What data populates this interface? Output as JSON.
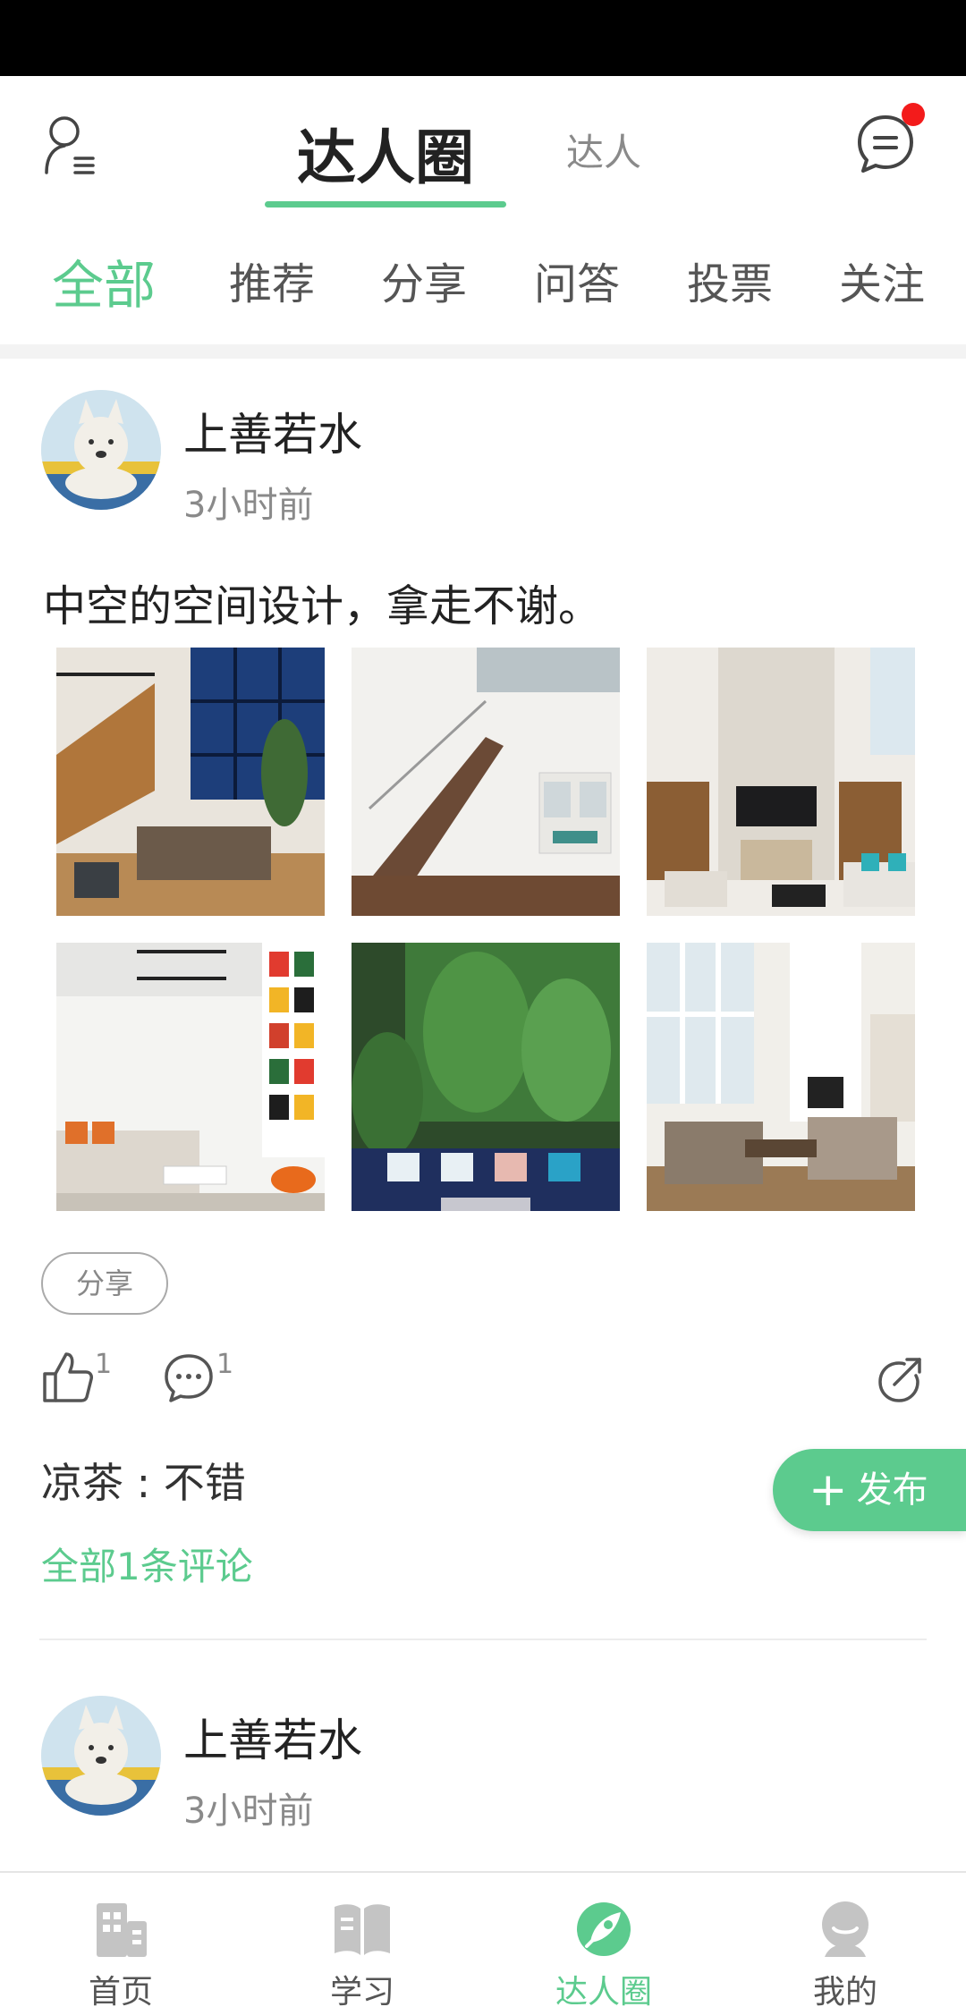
{
  "header": {
    "tab_main": "达人圈",
    "tab_second": "达人"
  },
  "categories": [
    "全部",
    "推荐",
    "分享",
    "问答",
    "投票",
    "关注"
  ],
  "post": {
    "author": "上善若水",
    "time": "3小时前",
    "text": "中空的空间设计，拿走不谢。",
    "tag": "分享",
    "like_count": "1",
    "comment_count": "1",
    "comment": "凉茶 : 不错",
    "all_comments": "全部1条评论"
  },
  "post2": {
    "author": "上善若水",
    "time": "3小时前"
  },
  "publish_button": {
    "plus": "+",
    "label": "发布"
  },
  "bottom_nav": {
    "items": [
      {
        "label": "首页",
        "icon": "home-building-icon"
      },
      {
        "label": "学习",
        "icon": "book-icon"
      },
      {
        "label": "达人圈",
        "icon": "circle-rocket-icon"
      },
      {
        "label": "我的",
        "icon": "profile-icon"
      }
    ],
    "active": "达人圈"
  },
  "colors": {
    "accent": "#5ccb8e",
    "badge": "#f31b1b",
    "muted": "#8a8a8a"
  }
}
